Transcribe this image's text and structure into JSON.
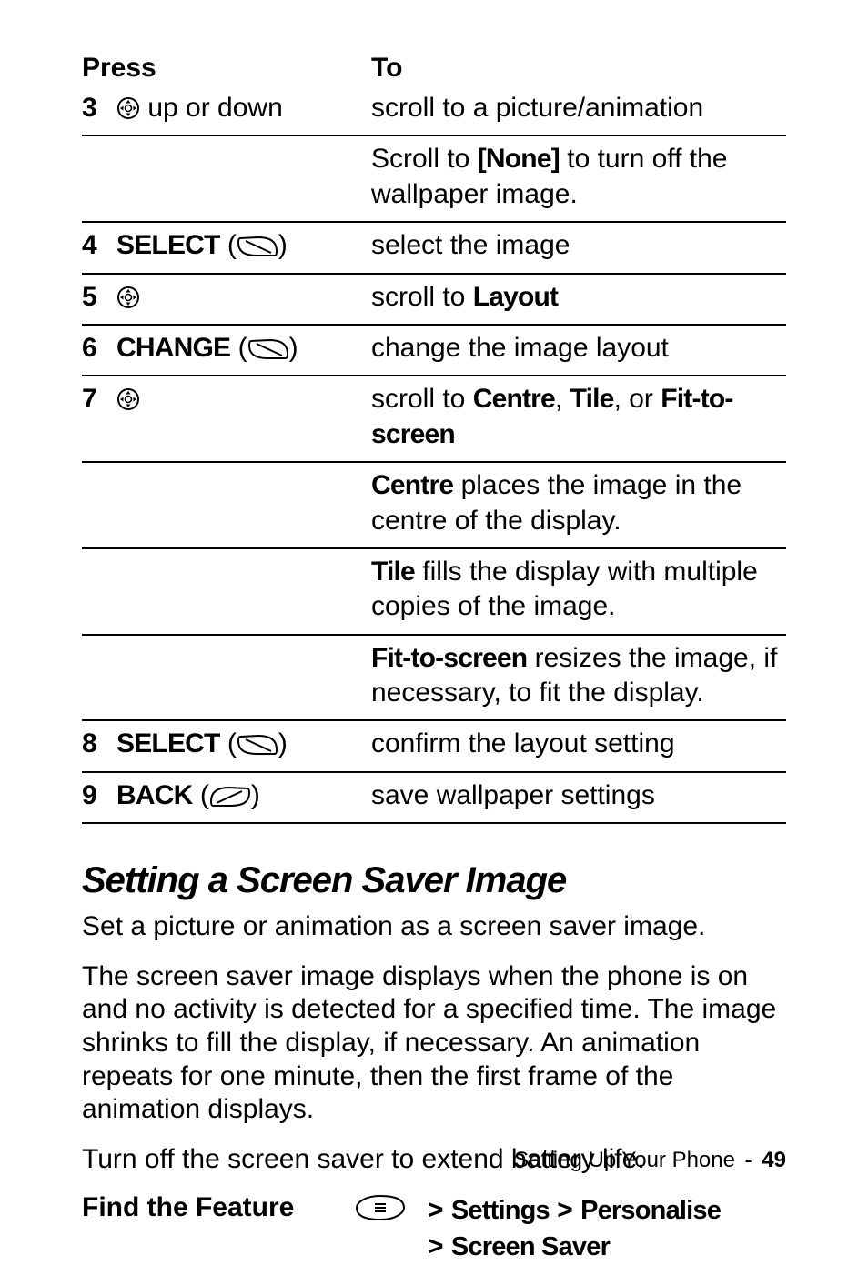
{
  "table": {
    "header": {
      "press": "Press",
      "to": "To"
    },
    "rows": [
      {
        "step": "3",
        "press_leading_icon": "nav",
        "press_text": "up or down",
        "to_lines": [
          "scroll to a picture/animation"
        ],
        "sub_to_lines": [
          {
            "pre": "Scroll to ",
            "disp": "[None]",
            "post": " to turn off the wallpaper image."
          }
        ]
      },
      {
        "step": "4",
        "press_label": "SELECT",
        "press_btn_icon": "soft-right",
        "to_lines": [
          "select the image"
        ]
      },
      {
        "step": "5",
        "press_icon_only": "nav",
        "to_lines_rich": [
          {
            "pre": "scroll to ",
            "disp": "Layout",
            "post": ""
          }
        ]
      },
      {
        "step": "6",
        "press_label": "CHANGE",
        "press_btn_icon": "soft-right",
        "to_lines": [
          "change the image layout"
        ]
      },
      {
        "step": "7",
        "press_icon_only": "nav",
        "to_lines_rich": [
          {
            "pre": "scroll to ",
            "disp": "Centre",
            "mid": ", ",
            "disp2": "Tile",
            "mid2": ", or ",
            "disp3": "Fit-to-screen",
            "post": ""
          }
        ],
        "explain_blocks": [
          {
            "disp": "Centre",
            "text": " places the image in the centre of the display."
          },
          {
            "disp": "Tile",
            "text": " fills the display with multiple copies of the image."
          },
          {
            "disp": "Fit-to-screen",
            "text": " resizes the image, if necessary, to fit the display."
          }
        ]
      },
      {
        "step": "8",
        "press_label": "SELECT",
        "press_btn_icon": "soft-right",
        "to_lines": [
          "confirm the layout setting"
        ]
      },
      {
        "step": "9",
        "press_label": "BACK",
        "press_btn_icon": "soft-left",
        "to_lines": [
          "save wallpaper settings"
        ]
      }
    ]
  },
  "section": {
    "title": "Setting a Screen Saver Image",
    "p1": "Set a picture or animation as a screen saver image.",
    "p2": "The screen saver image displays when the phone is on and no activity is detected for a specified time. The image shrinks to fill the display, if necessary. An animation repeats for one minute, then the first frame of the animation displays.",
    "p3": "Turn off the screen saver to extend battery life."
  },
  "ftf": {
    "label": "Find the Feature",
    "path_line1_pre": "> ",
    "path_line1_a": "Settings",
    "path_line1_mid": " > ",
    "path_line1_b": "Personalise",
    "path_line2_pre": "> ",
    "path_line2_a": "Screen Saver"
  },
  "footer": {
    "text": "Setting Up Your Phone",
    "sep": " - ",
    "page": "49"
  }
}
